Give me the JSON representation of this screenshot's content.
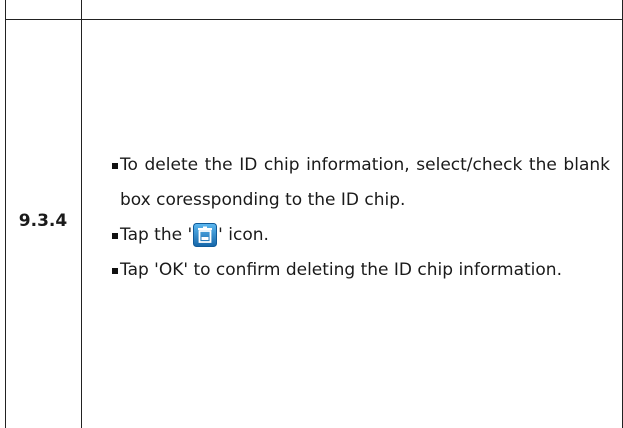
{
  "step": {
    "number": "9.3.4"
  },
  "instructions": {
    "item1": "To delete the ID chip information, select/check the blank box coressponding to the ID chip.",
    "item2_before": "Tap the '",
    "item2_icon": "trash-icon",
    "item2_after": "' icon.",
    "item3": "Tap 'OK' to confirm deleting the ID chip information."
  },
  "colors": {
    "icon_blue": "#2a8fd6",
    "icon_blue_dark": "#1565a8",
    "border": "#222222"
  }
}
